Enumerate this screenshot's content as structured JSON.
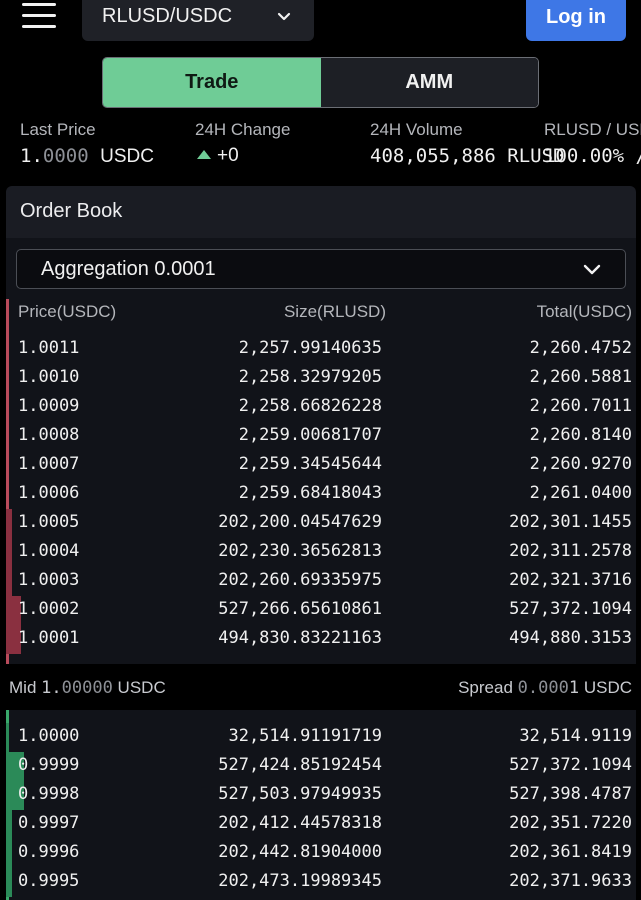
{
  "header": {
    "pair": "RLUSD/USDC",
    "login_label": "Log in"
  },
  "toggle": {
    "trade": "Trade",
    "amm": "AMM",
    "active": "trade"
  },
  "stats": {
    "last_price_label": "Last Price",
    "last_price_main": "1.",
    "last_price_dim": "0000",
    "last_price_unit": "USDC",
    "change_label": "24H Change",
    "change_value": "+0",
    "volume_label": "24H Volume",
    "volume_value": "408,055,886",
    "volume_unit": "RLUSD",
    "ratio_label": "RLUSD / USD",
    "ratio_value": "100.00% /"
  },
  "order_book": {
    "title": "Order Book",
    "aggregation": "Aggregation 0.0001",
    "headers": {
      "price": "Price(USDC)",
      "size": "Size(RLUSD)",
      "total": "Total(USDC)"
    },
    "asks": [
      {
        "price": "1.0011",
        "size": "2,257.99140635",
        "total": "2,260.4752",
        "depth": 0.0
      },
      {
        "price": "1.0010",
        "size": "2,258.32979205",
        "total": "2,260.5881",
        "depth": 0.0
      },
      {
        "price": "1.0009",
        "size": "2,258.66826228",
        "total": "2,260.7011",
        "depth": 0.0
      },
      {
        "price": "1.0008",
        "size": "2,259.00681707",
        "total": "2,260.8140",
        "depth": 0.0
      },
      {
        "price": "1.0007",
        "size": "2,259.34545644",
        "total": "2,260.9270",
        "depth": 0.0
      },
      {
        "price": "1.0006",
        "size": "2,259.68418043",
        "total": "2,261.0400",
        "depth": 0.0
      },
      {
        "price": "1.0005",
        "size": "202,200.04547629",
        "total": "202,301.1455",
        "depth": 0.2
      },
      {
        "price": "1.0004",
        "size": "202,230.36562813",
        "total": "202,311.2578",
        "depth": 0.2
      },
      {
        "price": "1.0003",
        "size": "202,260.69335975",
        "total": "202,321.3716",
        "depth": 0.2
      },
      {
        "price": "1.0002",
        "size": "527,266.65610861",
        "total": "527,372.1094",
        "depth": 0.5
      },
      {
        "price": "1.0001",
        "size": "494,830.83221163",
        "total": "494,880.3153",
        "depth": 0.5
      }
    ],
    "mid_label": "Mid",
    "mid_main": "1.",
    "mid_dim": "00000",
    "mid_unit": "USDC",
    "spread_label": "Spread",
    "spread_dim": "0.000",
    "spread_main": "1",
    "spread_unit": "USDC",
    "bids": [
      {
        "price": "1.0000",
        "size": "32,514.91191719",
        "total": "32,514.9119",
        "depth": 0.1
      },
      {
        "price": "0.9999",
        "size": "527,424.85192454",
        "total": "527,372.1094",
        "depth": 0.6
      },
      {
        "price": "0.9998",
        "size": "527,503.97949935",
        "total": "527,398.4787",
        "depth": 0.6
      },
      {
        "price": "0.9997",
        "size": "202,412.44578318",
        "total": "202,351.7220",
        "depth": 0.2
      },
      {
        "price": "0.9996",
        "size": "202,442.81904000",
        "total": "202,361.8419",
        "depth": 0.2
      },
      {
        "price": "0.9995",
        "size": "202,473.19989345",
        "total": "202,371.9633",
        "depth": 0.2
      }
    ]
  },
  "colors": {
    "accent": "#6fcc96",
    "login": "#3e77e6",
    "ask": "#b94b5b",
    "bid": "#3aa86a"
  },
  "icons": {
    "menu": "hamburger-menu-icon",
    "chevron": "chevron-down-icon",
    "change": "triangle-up-icon"
  }
}
